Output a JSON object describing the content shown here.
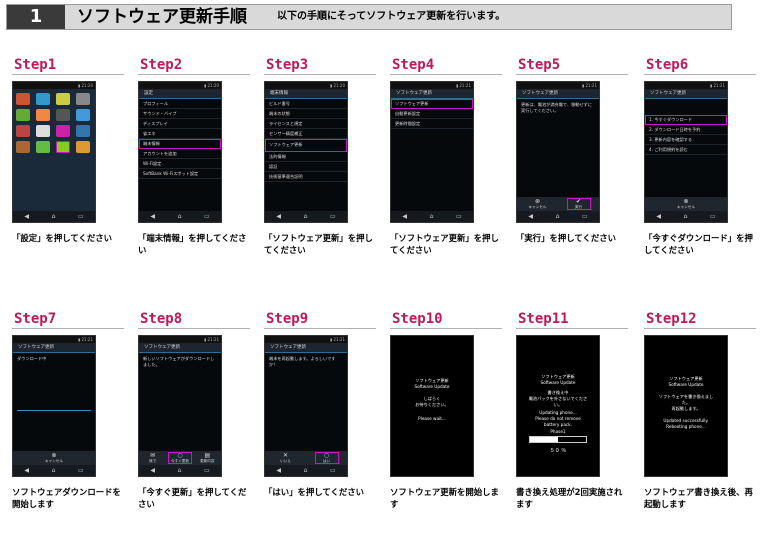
{
  "header": {
    "number": "1",
    "title": "ソフトウェア更新手順",
    "subtitle": "以下の手順にそってソフトウェア更新を行います。"
  },
  "steps": [
    {
      "label": "Step1",
      "caption": "「設定」を押してください"
    },
    {
      "label": "Step2",
      "caption": "「端末情報」を押してください"
    },
    {
      "label": "Step3",
      "caption": "「ソフトウェア更新」を押してください"
    },
    {
      "label": "Step4",
      "caption": "「ソフトウェア更新」を押してください"
    },
    {
      "label": "Step5",
      "caption": "「実行」を押してください"
    },
    {
      "label": "Step6",
      "caption": "「今すぐダウンロード」を押してください"
    },
    {
      "label": "Step7",
      "caption": "ソフトウェアダウンロードを開始します"
    },
    {
      "label": "Step8",
      "caption": "「今すぐ更新」を押してください"
    },
    {
      "label": "Step9",
      "caption": "「はい」を押してください"
    },
    {
      "label": "Step10",
      "caption": "ソフトウェア更新を開始します"
    },
    {
      "label": "Step11",
      "caption": "書き換え処理が2回実施されます"
    },
    {
      "label": "Step12",
      "caption": "ソフトウェア書き換え後、再起動します"
    }
  ],
  "screens": {
    "s2": {
      "title": "設定",
      "items": [
        "プロフィール",
        "サウンド・バイブ",
        "ディスプレイ",
        "省エネ",
        "端末情報",
        "アカウントを追加",
        "Wi-Fi設定",
        "SoftBank Wi-Fiスポット設定"
      ]
    },
    "s3": {
      "title": "端末情報",
      "items": [
        "ビルド番号",
        "端末の状態",
        "ライセンスと規定",
        "センサー精度補正",
        "ソフトウェア更新",
        "法的情報",
        "認証",
        "技術基準適合証明"
      ]
    },
    "s4": {
      "title": "ソフトウェア更新",
      "items": [
        "ソフトウェア更新",
        "自動更新設定",
        "更新時間設定"
      ]
    },
    "s5": {
      "title": "ソフトウェア更新",
      "body": "更新は、電池が満充電で、移動せずに実行してください。",
      "cancel": "キャンセル",
      "run": "実行"
    },
    "s6": {
      "title": "ソフトウェア更新",
      "options": [
        "1. 今すぐダウンロード",
        "2. ダウンロード日時を予約",
        "3. 更新内容を確認する",
        "4. ご利用規約を読む"
      ],
      "cancel": "キャンセル"
    },
    "s7": {
      "title": "ソフトウェア更新",
      "body": "ダウンロード中",
      "cancel": "キャンセル"
    },
    "s8": {
      "title": "ソフトウェア更新",
      "body": "新しいソフトウェアがダウンロードしました。",
      "later": "後で",
      "now": "今すぐ更新",
      "detail": "更新内容"
    },
    "s9": {
      "title": "ソフトウェア更新",
      "body": "端末を再起動します。よろしいですか？",
      "no": "いいえ",
      "yes": "はい"
    },
    "s10": {
      "line1": "ソフトウェア更新",
      "line2": "Software Update",
      "line3": "しばらく",
      "line4": "お待ちください。",
      "line5": "Please wait..."
    },
    "s11": {
      "line1": "ソフトウェア更新",
      "line2": "Software Update",
      "line3": "書き換え中",
      "line4": "電池パックを外さないでください。",
      "line5": "Updating phone...",
      "line6": "Please do not remove battery pack.",
      "phase": "Phase1",
      "percent": "５０ ％",
      "progress": 0.5
    },
    "s12": {
      "line1": "ソフトウェア更新",
      "line2": "Software Update",
      "line3": "ソフトウェアを書き換えました。",
      "line4": "再起動します。",
      "line5": "Updated successfully.",
      "line6": "Rebooting phone..."
    }
  }
}
